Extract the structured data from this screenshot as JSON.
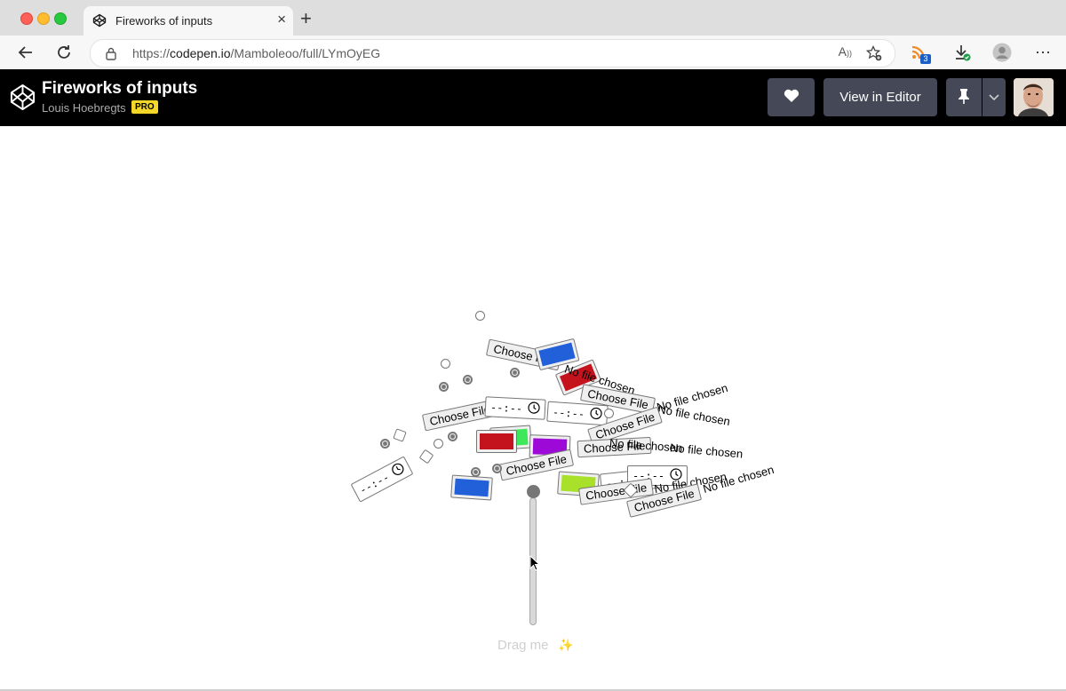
{
  "browser": {
    "tab_title": "Fireworks of inputs",
    "tab_icon": "codepen-icon",
    "url_prefix": "https://",
    "url_domain": "codepen.io",
    "url_path": "/Mamboleoo/full/LYmOyEG",
    "read_aloud_label": "A",
    "feeds_badge_count": "3"
  },
  "codepen": {
    "title": "Fireworks of inputs",
    "author": "Louis Hoebregts",
    "pro_badge": "PRO",
    "view_in_editor_label": "View in Editor"
  },
  "demo": {
    "slider_label": "Drag me",
    "slider_label_emoji": "✨",
    "file_button_label": "Choose File",
    "file_status_label": "No file chosen",
    "time_value": "--:--",
    "color_swatches": [
      "#2160d9",
      "#c4131d",
      "#3ee85a",
      "#9d09d6",
      "#a8e02a"
    ]
  }
}
